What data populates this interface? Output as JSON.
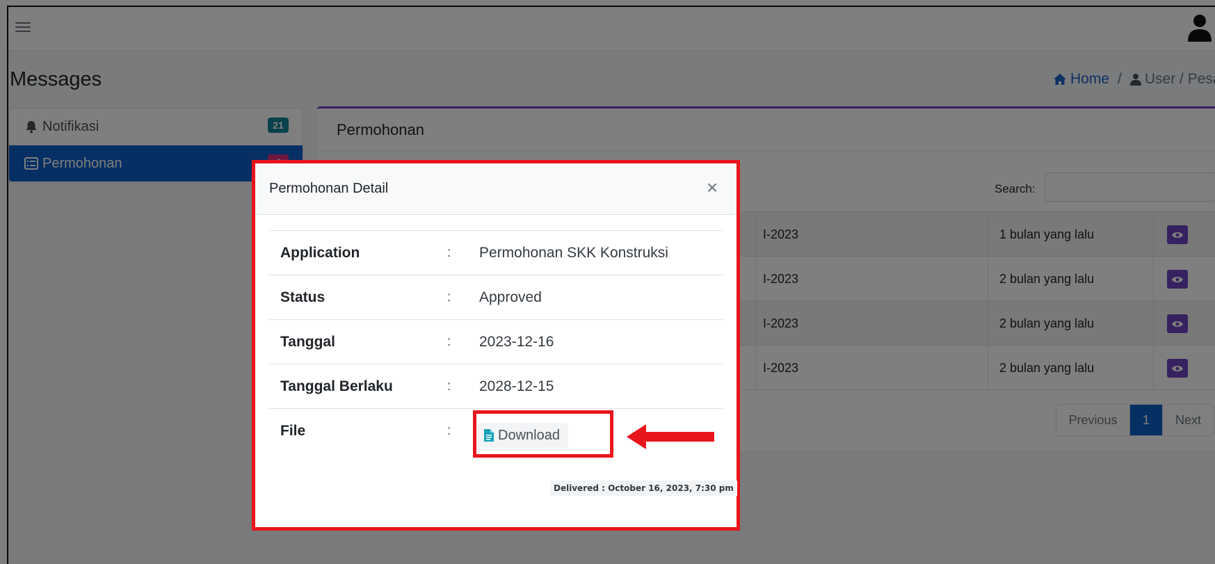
{
  "header": {
    "page_title": "Messages",
    "breadcrumb": {
      "home": "Home",
      "separator": "/",
      "user": "User / Pesa"
    }
  },
  "sidebar": {
    "items": [
      {
        "label": "Notifikasi",
        "badge": "21",
        "icon": "bell-icon"
      },
      {
        "label": "Permohonan",
        "badge": "4",
        "icon": "list-icon",
        "active": true
      }
    ]
  },
  "main": {
    "card_title": "Permohonan",
    "search_label": "Search:",
    "search_value": "",
    "rows": [
      {
        "code": "I-2023",
        "time": "1 bulan yang lalu"
      },
      {
        "code": "I-2023",
        "time": "2 bulan yang lalu"
      },
      {
        "code": "I-2023",
        "time": "2 bulan yang lalu"
      },
      {
        "code": "I-2023",
        "time": "2 bulan yang lalu"
      }
    ],
    "pagination": {
      "previous": "Previous",
      "current": "1",
      "next": "Next"
    }
  },
  "modal": {
    "title": "Permohonan Detail",
    "close_label": "×",
    "colon": ":",
    "fields": [
      {
        "key": "Application",
        "value": "Permohonan SKK Konstruksi"
      },
      {
        "key": "Status",
        "value": "Approved"
      },
      {
        "key": "Tanggal",
        "value": "2023-12-16"
      },
      {
        "key": "Tanggal Berlaku",
        "value": "2028-12-15"
      }
    ],
    "file": {
      "key": "File",
      "download_label": "Download"
    },
    "delivered": "Delivered : October 16, 2023, 7:30 pm"
  },
  "colors": {
    "primary": "#0d5ec8",
    "purple": "#6f42c1",
    "teal_badge": "#138496",
    "pink_badge": "#d63384",
    "highlight_red": "#e8161c"
  }
}
